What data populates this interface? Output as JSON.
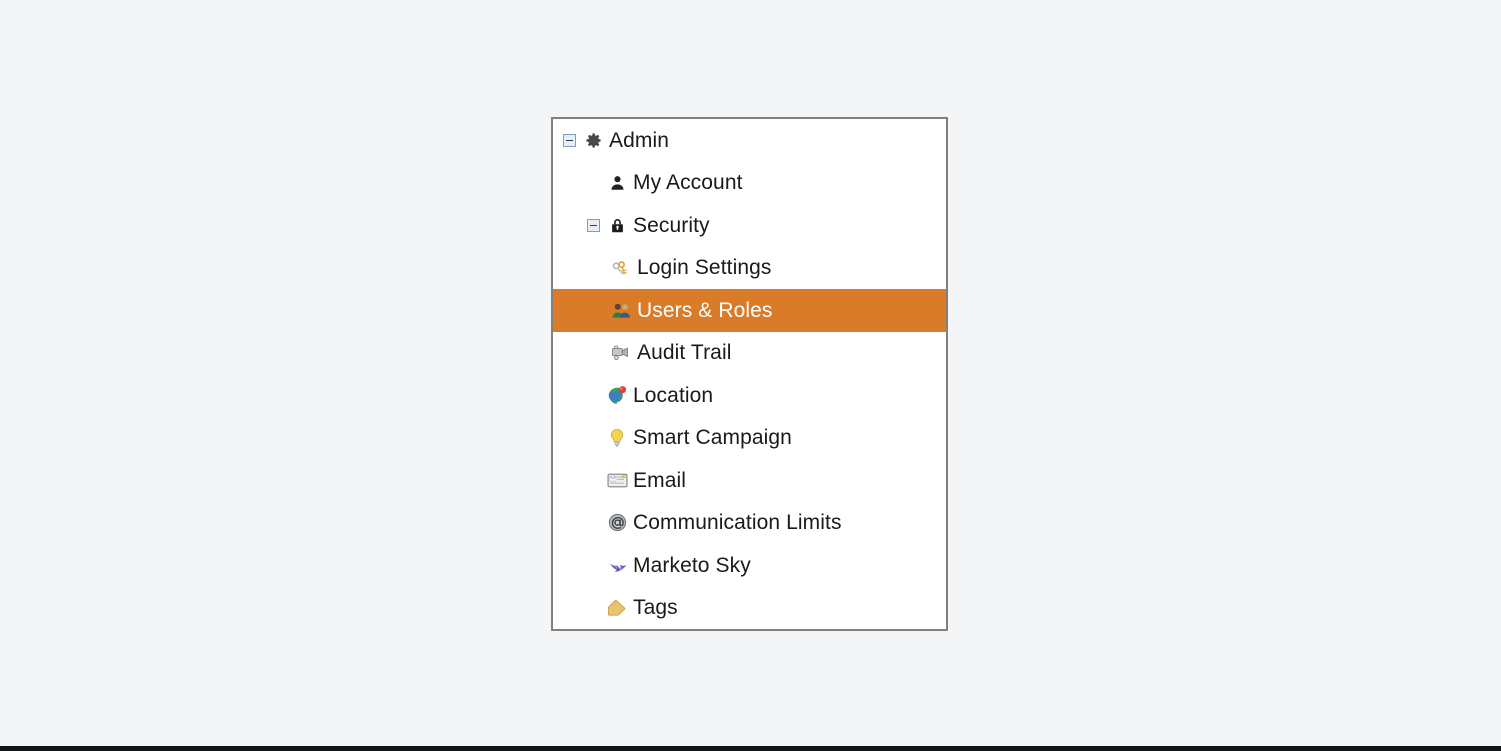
{
  "page": {
    "background_color": "#f4f5f7",
    "bottom_edge_color": "#111418"
  },
  "panel": {
    "name": "admin-navigation-tree",
    "background_color": "#ffffff",
    "border_color": "#808080",
    "selection_color": "#d97b29",
    "selection_text_color": "#ffffff",
    "text_color": "#1a1a1a"
  },
  "tree": {
    "items": [
      {
        "label": "Admin",
        "level": 0,
        "icon": "gear-icon",
        "toggle": "collapse-minus-icon",
        "expanded": true,
        "selected": false
      },
      {
        "label": "My Account",
        "level": 1,
        "icon": "person-icon",
        "toggle": null,
        "expanded": false,
        "selected": false
      },
      {
        "label": "Security",
        "level": 1,
        "icon": "lock-icon",
        "toggle": "collapse-minus-icon",
        "expanded": true,
        "selected": false
      },
      {
        "label": "Login Settings",
        "level": 2,
        "icon": "key-icon",
        "toggle": null,
        "expanded": false,
        "selected": false
      },
      {
        "label": "Users & Roles",
        "level": 2,
        "icon": "users-icon",
        "toggle": null,
        "expanded": false,
        "selected": true
      },
      {
        "label": "Audit Trail",
        "level": 2,
        "icon": "video-camera-icon",
        "toggle": null,
        "expanded": false,
        "selected": false
      },
      {
        "label": "Location",
        "level": 1,
        "icon": "globe-pin-icon",
        "toggle": null,
        "expanded": false,
        "selected": false
      },
      {
        "label": "Smart Campaign",
        "level": 1,
        "icon": "lightbulb-icon",
        "toggle": null,
        "expanded": false,
        "selected": false
      },
      {
        "label": "Email",
        "level": 1,
        "icon": "envelope-card-icon",
        "toggle": null,
        "expanded": false,
        "selected": false
      },
      {
        "label": "Communication Limits",
        "level": 1,
        "icon": "at-sign-icon",
        "toggle": null,
        "expanded": false,
        "selected": false
      },
      {
        "label": "Marketo Sky",
        "level": 1,
        "icon": "bird-icon",
        "toggle": null,
        "expanded": false,
        "selected": false
      },
      {
        "label": "Tags",
        "level": 1,
        "icon": "tag-icon",
        "toggle": null,
        "expanded": false,
        "selected": false
      }
    ]
  }
}
